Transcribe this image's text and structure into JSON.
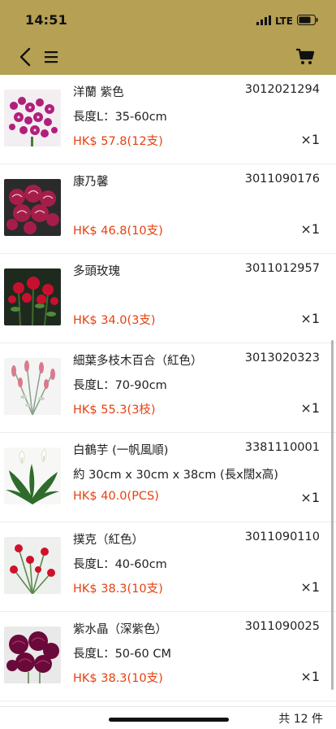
{
  "status_bar": {
    "time": "14:51",
    "network": "LTE"
  },
  "header": {
    "back_icon": "chevron-left-icon",
    "menu_icon": "hamburger-menu-icon",
    "cart_icon": "shopping-cart-icon",
    "background_color": "#b5a053"
  },
  "items": [
    {
      "name": "洋蘭 紫色",
      "code": "3012021294",
      "size": "長度L：35-60cm",
      "price": "HK$ 57.8(12支)",
      "qty": "×1",
      "image": "purple-orchid"
    },
    {
      "name": "康乃馨",
      "code": "3011090176",
      "size": "",
      "price": "HK$ 46.8(10支)",
      "qty": "×1",
      "image": "carnation-bunch"
    },
    {
      "name": "多頭玫瑰",
      "code": "3011012957",
      "size": "",
      "price": "HK$ 34.0(3支)",
      "qty": "×1",
      "image": "spray-rose"
    },
    {
      "name": "細葉多枝木百合（紅色）",
      "code": "3013020323",
      "size": "長度L：70-90cm",
      "price": "HK$ 55.3(3枝)",
      "qty": "×1",
      "image": "leucadendron"
    },
    {
      "name": "白鶴芋 (一帆風順)",
      "code": "3381110001",
      "size": "約 30cm x 30cm x 38cm (長x闊x高)",
      "price": "HK$ 40.0(PCS)",
      "qty": "×1",
      "image": "peace-lily"
    },
    {
      "name": "撲克（紅色）",
      "code": "3011090110",
      "size": "長度L：40-60cm",
      "price": "HK$ 38.3(10支)",
      "qty": "×1",
      "image": "red-carnation-stems"
    },
    {
      "name": "紫水晶（深紫色）",
      "code": "3011090025",
      "size": "長度L：50-60 CM",
      "price": "HK$ 38.3(10支)",
      "qty": "×1",
      "image": "dark-purple-carnation"
    }
  ],
  "footer": {
    "total_label": "共 12 件"
  },
  "colors": {
    "price": "#e8400f",
    "accent": "#b5a053"
  }
}
